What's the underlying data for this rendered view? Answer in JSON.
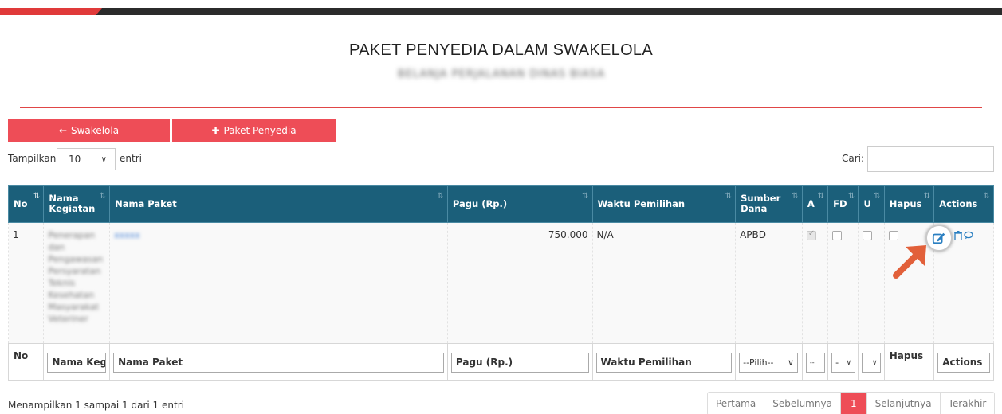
{
  "header": {
    "title": "PAKET PENYEDIA DALAM SWAKELOLA",
    "subtitle": "BELANJA PERJALANAN DINAS BIASA"
  },
  "buttons": {
    "swakelola_label": "Swakelola",
    "paket_label": "Paket Penyedia"
  },
  "controls": {
    "show_label": "Tampilkan",
    "show_value": "10",
    "entries_label": "entri",
    "search_label": "Cari:"
  },
  "table": {
    "columns": [
      "No",
      "Nama Kegiatan",
      "Nama Paket",
      "Pagu (Rp.)",
      "Waktu Pemilihan",
      "Sumber Dana",
      "A",
      "FD",
      "U",
      "Hapus",
      "Actions"
    ],
    "rows": [
      {
        "no": "1",
        "nama_kegiatan": "Penerapan dan Pengawasan Persyaratan Teknis Kesehatan Masyarakat Veteriner",
        "nama_paket": "xxxxx",
        "pagu": "750.000",
        "waktu": "N/A",
        "sumber_dana": "APBD",
        "a_checked": true,
        "fd_checked": false,
        "u_checked": false,
        "hapus_checked": false
      }
    ],
    "footer": {
      "no": "No",
      "nama_kegiatan": "Nama Kegi",
      "nama_paket": "Nama Paket",
      "pagu": "Pagu (Rp.)",
      "waktu": "Waktu Pemilihan",
      "sumber_dana": "--Pilih--",
      "a": "--",
      "fd": "-",
      "u": "",
      "hapus": "Hapus",
      "actions": "Actions"
    }
  },
  "info": "Menampilkan 1 sampai 1 dari 1 entri",
  "pagination": {
    "first": "Pertama",
    "prev": "Sebelumnya",
    "current": "1",
    "next": "Selanjutnya",
    "last": "Terakhir"
  },
  "colors": {
    "header_bg": "#1b5f7a",
    "accent_red": "#ee4d57",
    "edit_icon": "#2a7fc1",
    "arrow": "#e2603a"
  },
  "icons": [
    "arrow-left-icon",
    "plus-icon",
    "edit-icon",
    "trash-icon",
    "comment-icon",
    "sort-icon",
    "chevron-down-icon",
    "pointer-arrow"
  ]
}
